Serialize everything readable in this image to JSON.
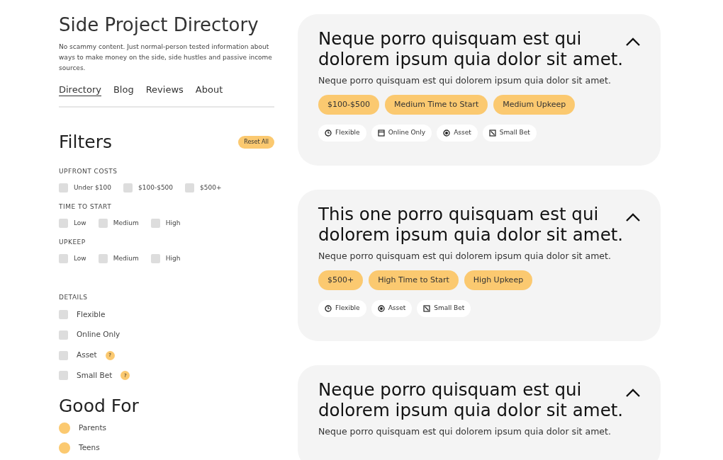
{
  "site": {
    "title": "Side Project Directory",
    "tagline": "No scammy content. Just normal-person tested information about ways to make money on the side, side hustles and passive income sources.",
    "nav": [
      {
        "label": "Directory",
        "selected": true
      },
      {
        "label": "Blog",
        "selected": false
      },
      {
        "label": "Reviews",
        "selected": false
      },
      {
        "label": "About",
        "selected": false
      }
    ]
  },
  "filters": {
    "title": "Filters",
    "reset": "Reset All",
    "groups": [
      {
        "label": "UPFRONT COSTS",
        "options": [
          {
            "label": "Under $100",
            "checked": false
          },
          {
            "label": "$100-$500",
            "checked": false
          },
          {
            "label": "$500+",
            "checked": false
          }
        ]
      },
      {
        "label": "TIME TO START",
        "options": [
          {
            "label": "Low",
            "checked": false
          },
          {
            "label": "Medium",
            "checked": false
          },
          {
            "label": "High",
            "checked": false
          }
        ]
      },
      {
        "label": "UPKEEP",
        "options": [
          {
            "label": "Low",
            "checked": false
          },
          {
            "label": "Medium",
            "checked": false
          },
          {
            "label": "High",
            "checked": false
          }
        ]
      }
    ],
    "details": {
      "label": "DETAILS",
      "options": [
        {
          "label": "Flexible",
          "checked": false
        },
        {
          "label": "Online Only",
          "checked": false
        },
        {
          "label": "Asset",
          "checked": false,
          "help_text": "?"
        },
        {
          "label": "Small Bet",
          "checked": false,
          "help_text": "?"
        }
      ]
    }
  },
  "good_for": {
    "title": "Good For",
    "options": [
      {
        "label": "Parents",
        "checked": false
      },
      {
        "label": "Teens",
        "checked": false
      }
    ]
  },
  "cards": [
    {
      "title": "Neque porro quisquam est qui dolorem ipsum quia dolor sit amet.",
      "expanded": true,
      "description": "Neque porro quisquam est qui dolorem ipsum quia dolor sit amet.",
      "tags": [
        "$100-$500",
        "Medium Time to Start",
        "Medium Upkeep"
      ],
      "details": [
        {
          "kind": "clock",
          "label": "Flexible"
        },
        {
          "kind": "window",
          "label": "Online Only"
        },
        {
          "kind": "coin",
          "label": "Asset"
        },
        {
          "kind": "bet",
          "label": "Small Bet"
        }
      ]
    },
    {
      "title": "This one porro quisquam est qui dolorem ipsum quia dolor sit amet.",
      "expanded": true,
      "description": "Neque porro quisquam est qui dolorem ipsum quia dolor sit amet.",
      "tags": [
        "$500+",
        "High Time to Start",
        "High Upkeep"
      ],
      "details": [
        {
          "kind": "clock",
          "label": "Flexible"
        },
        {
          "kind": "coin",
          "label": "Asset"
        },
        {
          "kind": "bet",
          "label": "Small Bet"
        }
      ]
    },
    {
      "title": "Neque porro quisquam est qui dolorem ipsum quia dolor sit amet.",
      "expanded": true,
      "description": "Neque porro quisquam est qui dolorem ipsum quia dolor sit amet."
    }
  ]
}
